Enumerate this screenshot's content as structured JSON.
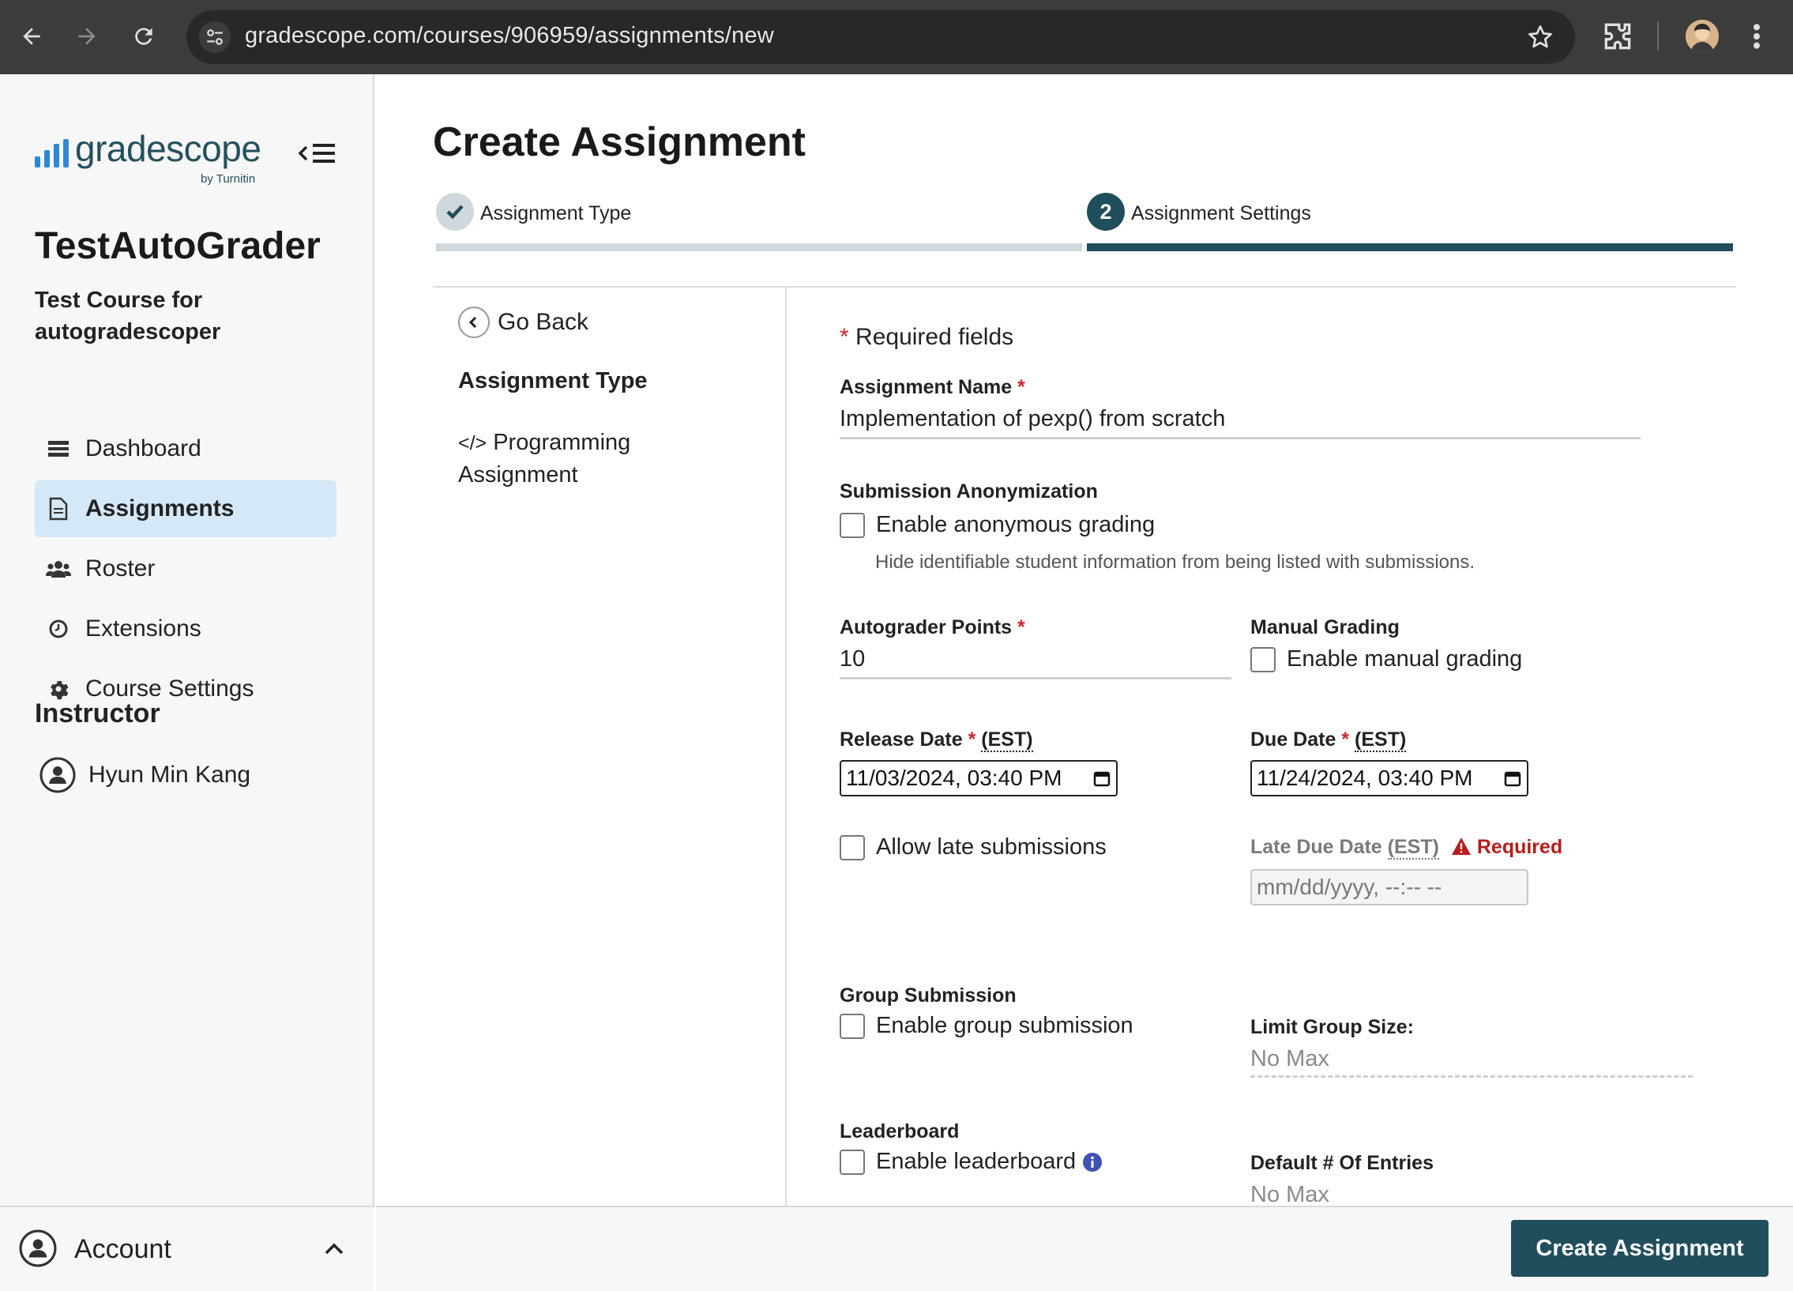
{
  "browser": {
    "url": "gradescope.com/courses/906959/assignments/new"
  },
  "sidebar": {
    "logo_text": "gradescope",
    "logo_sub": "by Turnitin",
    "course_title": "TestAutoGrader",
    "course_subtitle": "Test Course for autogradescoper",
    "nav": [
      {
        "label": "Dashboard",
        "icon": "dashboard-icon"
      },
      {
        "label": "Assignments",
        "icon": "document-icon"
      },
      {
        "label": "Roster",
        "icon": "users-icon"
      },
      {
        "label": "Extensions",
        "icon": "clock-icon"
      },
      {
        "label": "Course Settings",
        "icon": "gear-icon"
      }
    ],
    "instructor_heading": "Instructor",
    "instructor_name": "Hyun Min Kang",
    "account_label": "Account"
  },
  "main": {
    "title": "Create Assignment",
    "steps": [
      {
        "label": "Assignment Type",
        "state": "done"
      },
      {
        "number": "2",
        "label": "Assignment Settings",
        "state": "active"
      }
    ],
    "left_panel": {
      "go_back": "Go Back",
      "heading": "Assignment Type",
      "type_icon": "</>",
      "type_label": "Programming Assignment"
    },
    "form": {
      "required_star": "*",
      "required_note": "Required fields",
      "assignment_name_label": "Assignment Name",
      "assignment_name_value": "Implementation of pexp() from scratch",
      "anon_label": "Submission Anonymization",
      "anon_checkbox": "Enable anonymous grading",
      "anon_help": "Hide identifiable student information from being listed with submissions.",
      "autograder_label": "Autograder Points",
      "autograder_value": "10",
      "manual_label": "Manual Grading",
      "manual_checkbox": "Enable manual grading",
      "release_label": "Release Date",
      "tz": "(EST)",
      "release_value": "11/03/2024, 03:40 PM",
      "due_label": "Due Date",
      "due_value": "11/24/2024, 03:40 PM",
      "late_checkbox": "Allow late submissions",
      "late_due_label": "Late Due Date",
      "late_due_warning": "Required",
      "late_due_placeholder": "mm/dd/yyyy, --:-- --",
      "group_label": "Group Submission",
      "group_checkbox": "Enable group submission",
      "limit_group_label": "Limit Group Size:",
      "limit_group_value": "No Max",
      "leaderboard_label": "Leaderboard",
      "leaderboard_checkbox": "Enable leaderboard",
      "default_entries_label": "Default # Of Entries",
      "default_entries_value": "No Max"
    },
    "create_button": "Create Assignment"
  }
}
